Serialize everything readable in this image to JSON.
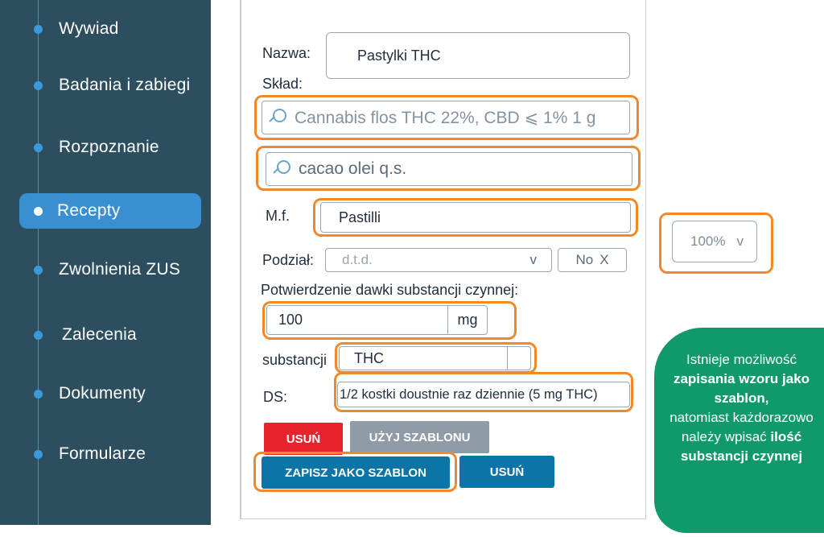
{
  "sidebar": {
    "items": [
      {
        "label": "Wywiad"
      },
      {
        "label": "Badania i zabiegi"
      },
      {
        "label": "Rozpoznanie"
      },
      {
        "label": "Recepty"
      },
      {
        "label": "Zwolnienia ZUS"
      },
      {
        "label": "Zalecenia"
      },
      {
        "label": "Dokumenty"
      },
      {
        "label": "Formularze"
      }
    ],
    "active": "Recepty"
  },
  "form": {
    "name_label": "Nazwa:",
    "name_value": "Pastylki THC",
    "composition_label": "Skład:",
    "ingredient_1": "Cannabis flos THC 22%, CBD ⩽ 1% 1 g",
    "ingredient_2": "cacao olei q.s.",
    "mf_label": "M.f.",
    "mf_value": "Pastilli",
    "division_label": "Podział:",
    "division_value": "d.t.d.",
    "division_chevron": "v",
    "no_label": "No",
    "no_value": "X",
    "dose_confirm_label": "Potwierdzenie dawki substancji czynnej:",
    "dose_value": "100",
    "dose_unit": "mg",
    "substance_label": "substancji",
    "substance_value": "THC",
    "ds_label": "DS:",
    "ds_value": "1/2 kostki doustnie raz dziennie (5 mg THC)"
  },
  "buttons": {
    "delete_red": "USUŃ",
    "use_template": "UŻYJ SZABLONU",
    "save_template": "ZAPISZ JAKO SZABLON",
    "delete_blue": "USUŃ"
  },
  "percent_select": {
    "value": "100%",
    "chevron": "v"
  },
  "callout": {
    "line1": "Istnieje możliwość",
    "bold1": "zapisania wzoru jako szablon,",
    "line2": "natomiast każdorazowo należy wpisać",
    "bold2": "ilość substancji czynnej"
  },
  "colors": {
    "sidebar": "#2c4e5f",
    "active": "#3a8fd1",
    "highlight": "#f0892b",
    "red": "#e8222a",
    "gray": "#8f9ba6",
    "blue": "#0d74a8",
    "callout": "#109a6c"
  }
}
